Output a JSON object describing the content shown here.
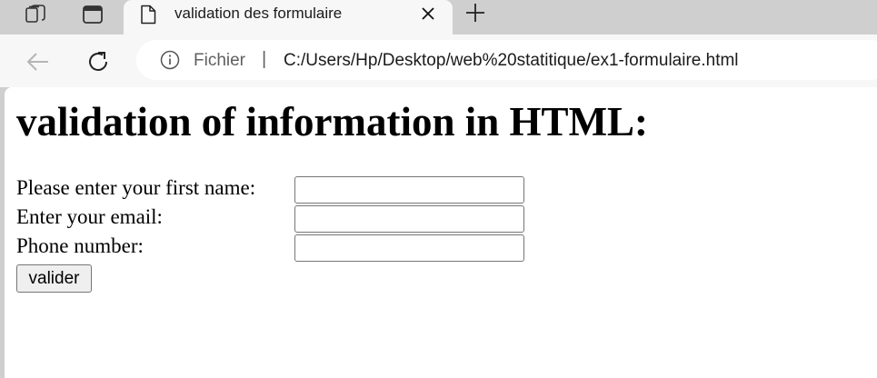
{
  "browser": {
    "tab": {
      "title": "validation des formulaire"
    },
    "address": {
      "label": "Fichier",
      "separator": "|",
      "url": "C:/Users/Hp/Desktop/web%20statitique/ex1-formulaire.html"
    }
  },
  "page": {
    "title": "validation of information in HTML:",
    "form": {
      "fields": [
        {
          "label": "Please enter your first name:",
          "value": ""
        },
        {
          "label": "Enter your email:",
          "value": ""
        },
        {
          "label": "Phone number:",
          "value": ""
        }
      ],
      "submit_label": "valider"
    }
  }
}
